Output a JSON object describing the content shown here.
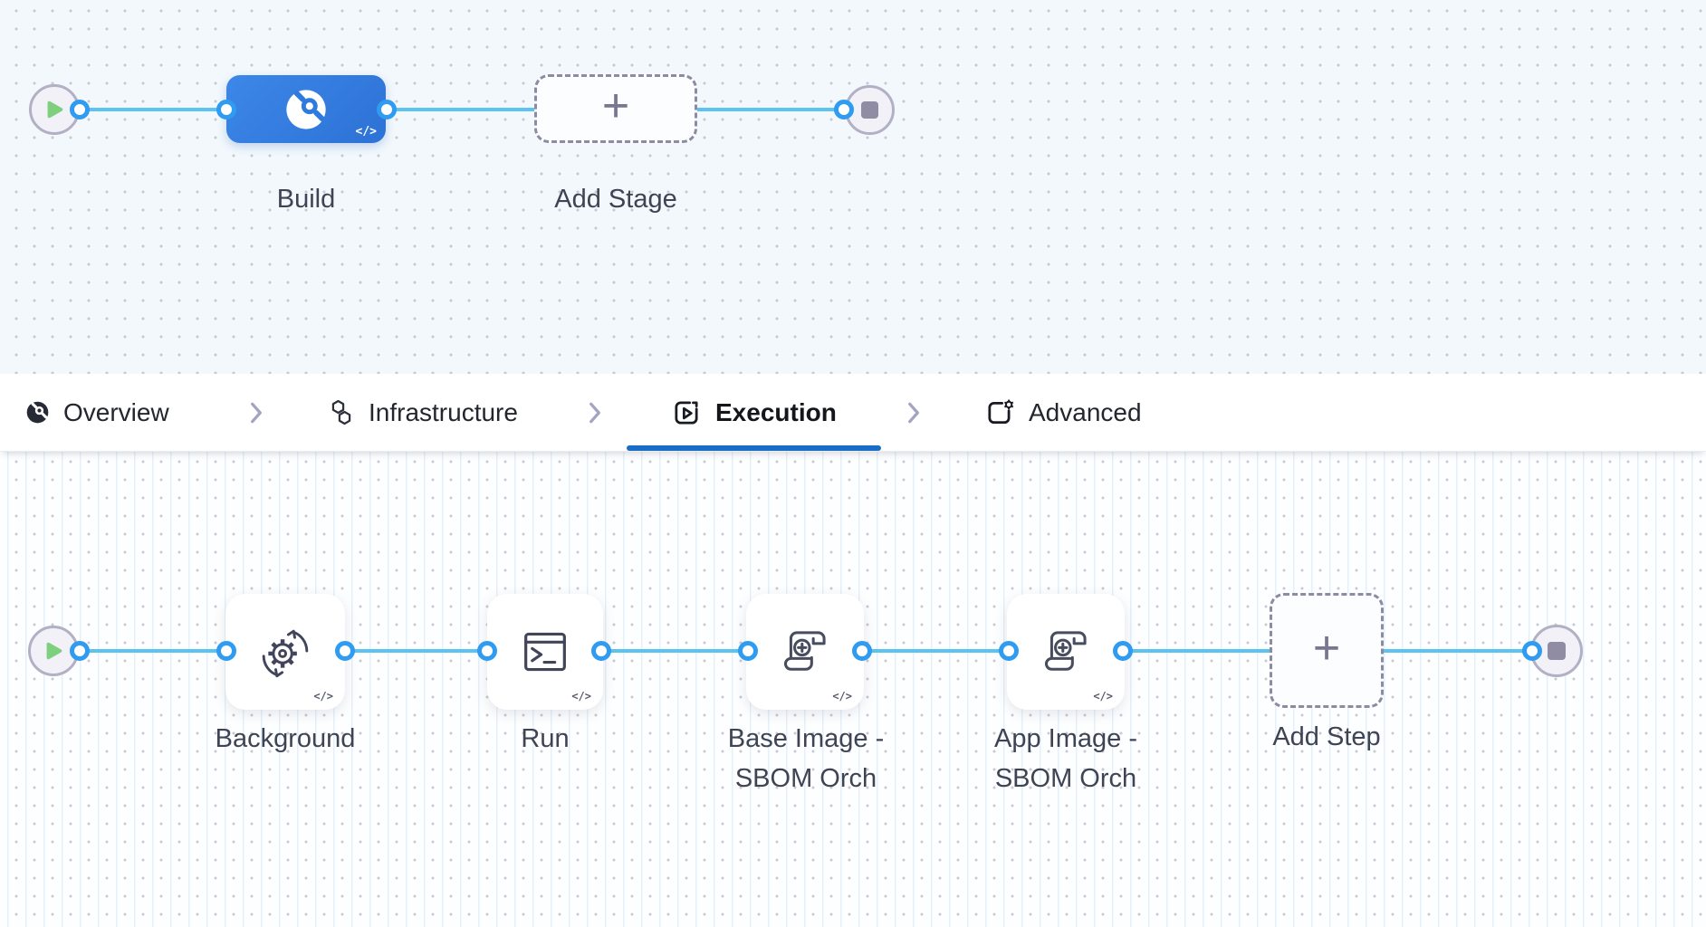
{
  "stage_canvas": {
    "build_stage": {
      "label": "Build",
      "code_badge": "</>"
    },
    "add_stage": {
      "label": "Add Stage",
      "plus": "+"
    }
  },
  "tab_bar": {
    "tabs": [
      {
        "label": "Overview",
        "icon": "pipeline-overview-icon",
        "active": false
      },
      {
        "label": "Infrastructure",
        "icon": "hexagons-icon",
        "active": false
      },
      {
        "label": "Execution",
        "icon": "play-square-icon",
        "active": true
      },
      {
        "label": "Advanced",
        "icon": "page-gear-icon",
        "active": false
      }
    ]
  },
  "step_canvas": {
    "steps": [
      {
        "line1": "Background",
        "line2": "",
        "icon": "sync-gear-icon",
        "code_badge": "</>"
      },
      {
        "line1": "Run",
        "line2": "",
        "icon": "terminal-icon",
        "code_badge": "</>"
      },
      {
        "line1": "Base Image -",
        "line2": "SBOM Orch",
        "icon": "scroll-plus-icon",
        "code_badge": "</>"
      },
      {
        "line1": "App Image -",
        "line2": "SBOM Orch",
        "icon": "scroll-plus-icon",
        "code_badge": "</>"
      }
    ],
    "add_step": {
      "label": "Add Step",
      "plus": "+"
    }
  },
  "colors": {
    "edge_line": "#5cc2ef",
    "connector_ring": "#2f9bf1",
    "stage_node_blue": "#2f7ade",
    "active_tab_underline": "#1a6dc6",
    "start_play_green": "#7ed07e",
    "end_stop_gray": "#8f8ca4",
    "canvas_top_bg": "#f2f8fc",
    "canvas_bottom_bg": "#fdfeff"
  }
}
